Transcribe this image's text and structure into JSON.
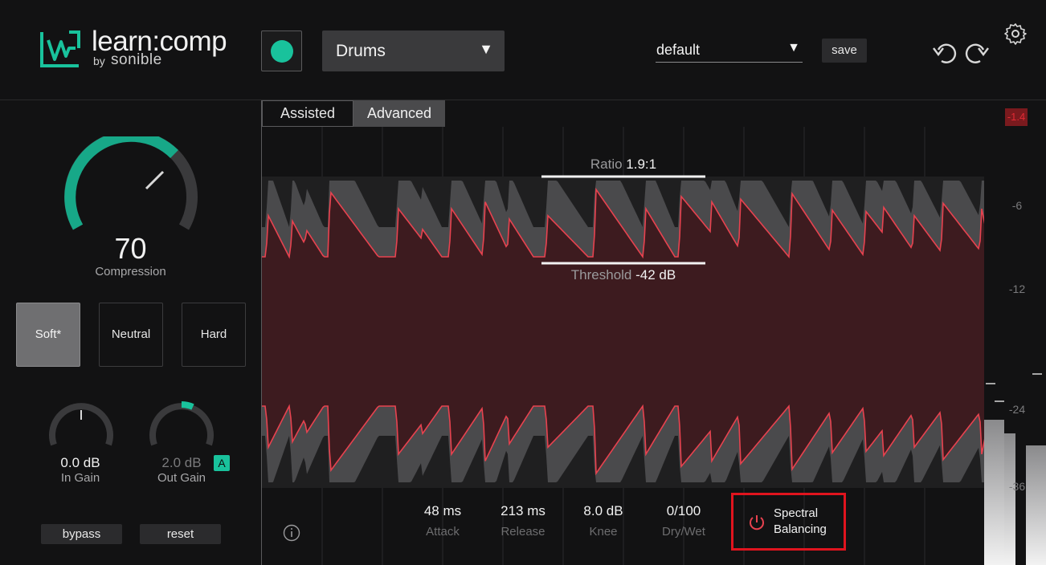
{
  "header": {
    "logo_text": "learn:comp",
    "logo_by": "by",
    "logo_brand": "sonible",
    "profile": "Drums",
    "preset": "default",
    "save_label": "save"
  },
  "icons": {
    "profile_arrow": "▼",
    "preset_arrow": "▼"
  },
  "colors": {
    "accent": "#19c29c",
    "waveform": "#e8424f",
    "highlight": "#e0141e"
  },
  "tabs": [
    {
      "label": "Assisted"
    },
    {
      "label": "Advanced"
    }
  ],
  "compression": {
    "value": "70",
    "label": "Compression",
    "level": 0.7
  },
  "modes": [
    {
      "label": "Soft*"
    },
    {
      "label": "Neutral"
    },
    {
      "label": "Hard"
    }
  ],
  "in_gain": {
    "value": "0.0 dB",
    "label": "In Gain"
  },
  "out_gain": {
    "value": "2.0 dB",
    "label": "Out Gain",
    "auto_badge": "A"
  },
  "footer": {
    "bypass": "bypass",
    "reset": "reset"
  },
  "ratio": {
    "label": "Ratio",
    "value": "1.9:1"
  },
  "threshold": {
    "label": "Threshold",
    "value": "-42 dB"
  },
  "params": [
    {
      "value": "48 ms",
      "label": "Attack"
    },
    {
      "value": "213 ms",
      "label": "Release"
    },
    {
      "value": "8.0 dB",
      "label": "Knee"
    },
    {
      "value": "0/100",
      "label": "Dry/Wet"
    }
  ],
  "spectral": {
    "line1": "Spectral",
    "line2": "Balancing"
  },
  "meter": {
    "peak": "-1.4",
    "ticks": [
      "-6",
      "-12",
      "-24",
      "-36"
    ]
  }
}
